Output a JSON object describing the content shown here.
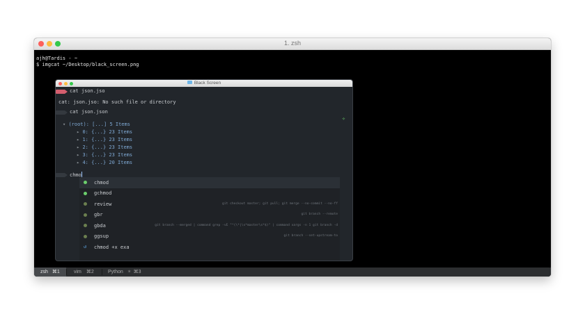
{
  "window": {
    "title": "1. zsh"
  },
  "terminal": {
    "prompt_user": "ajh@Tardis",
    "prompt_dir": "~",
    "prompt_sep": "∘",
    "command": "$ imgcat ~/Desktop/black_screen.png"
  },
  "image_window": {
    "title": "Black Screen",
    "lines": {
      "cmd1": "cat json.jso",
      "error": "cat: json.jso: No such file or directory",
      "cmd2": "cat json.json",
      "root": "(root): [...] 5 Items",
      "items": [
        "0: {...} 23 Items",
        "1: {...} 23 Items",
        "2: {...} 23 Items",
        "3: {...} 23 Items",
        "4: {...} 20 Items"
      ],
      "input": "chmo"
    },
    "autocomplete": [
      {
        "label": "chmod",
        "desc": "",
        "color": "#6ccf6c"
      },
      {
        "label": "gchmod",
        "desc": "",
        "color": "#6ccf6c"
      },
      {
        "label": "review",
        "desc": "git checkout master; git pull; git merge --no-commit --no-ff",
        "color": "#6b7f4f"
      },
      {
        "label": "gbr",
        "desc": "git branch --remote",
        "color": "#6b7f4f"
      },
      {
        "label": "gbda",
        "desc": "git branch --merged | command grep -vE \"^(\\*|\\s*master\\s*$)\" | command xargs -n 1 git branch -d",
        "color": "#6b7f4f"
      },
      {
        "label": "ggsup",
        "desc": "git branch --set-upstream-to",
        "color": "#6b7f4f"
      },
      {
        "label": "chmod +x exa",
        "desc": "",
        "color": "#5fa8e8"
      }
    ]
  },
  "tabs": [
    {
      "name": "zsh",
      "shortcut": "⌘1",
      "active": true
    },
    {
      "name": "vim",
      "shortcut": "⌘2",
      "active": false
    },
    {
      "name": "Python",
      "shortcut": "⌘3",
      "active": false
    }
  ]
}
